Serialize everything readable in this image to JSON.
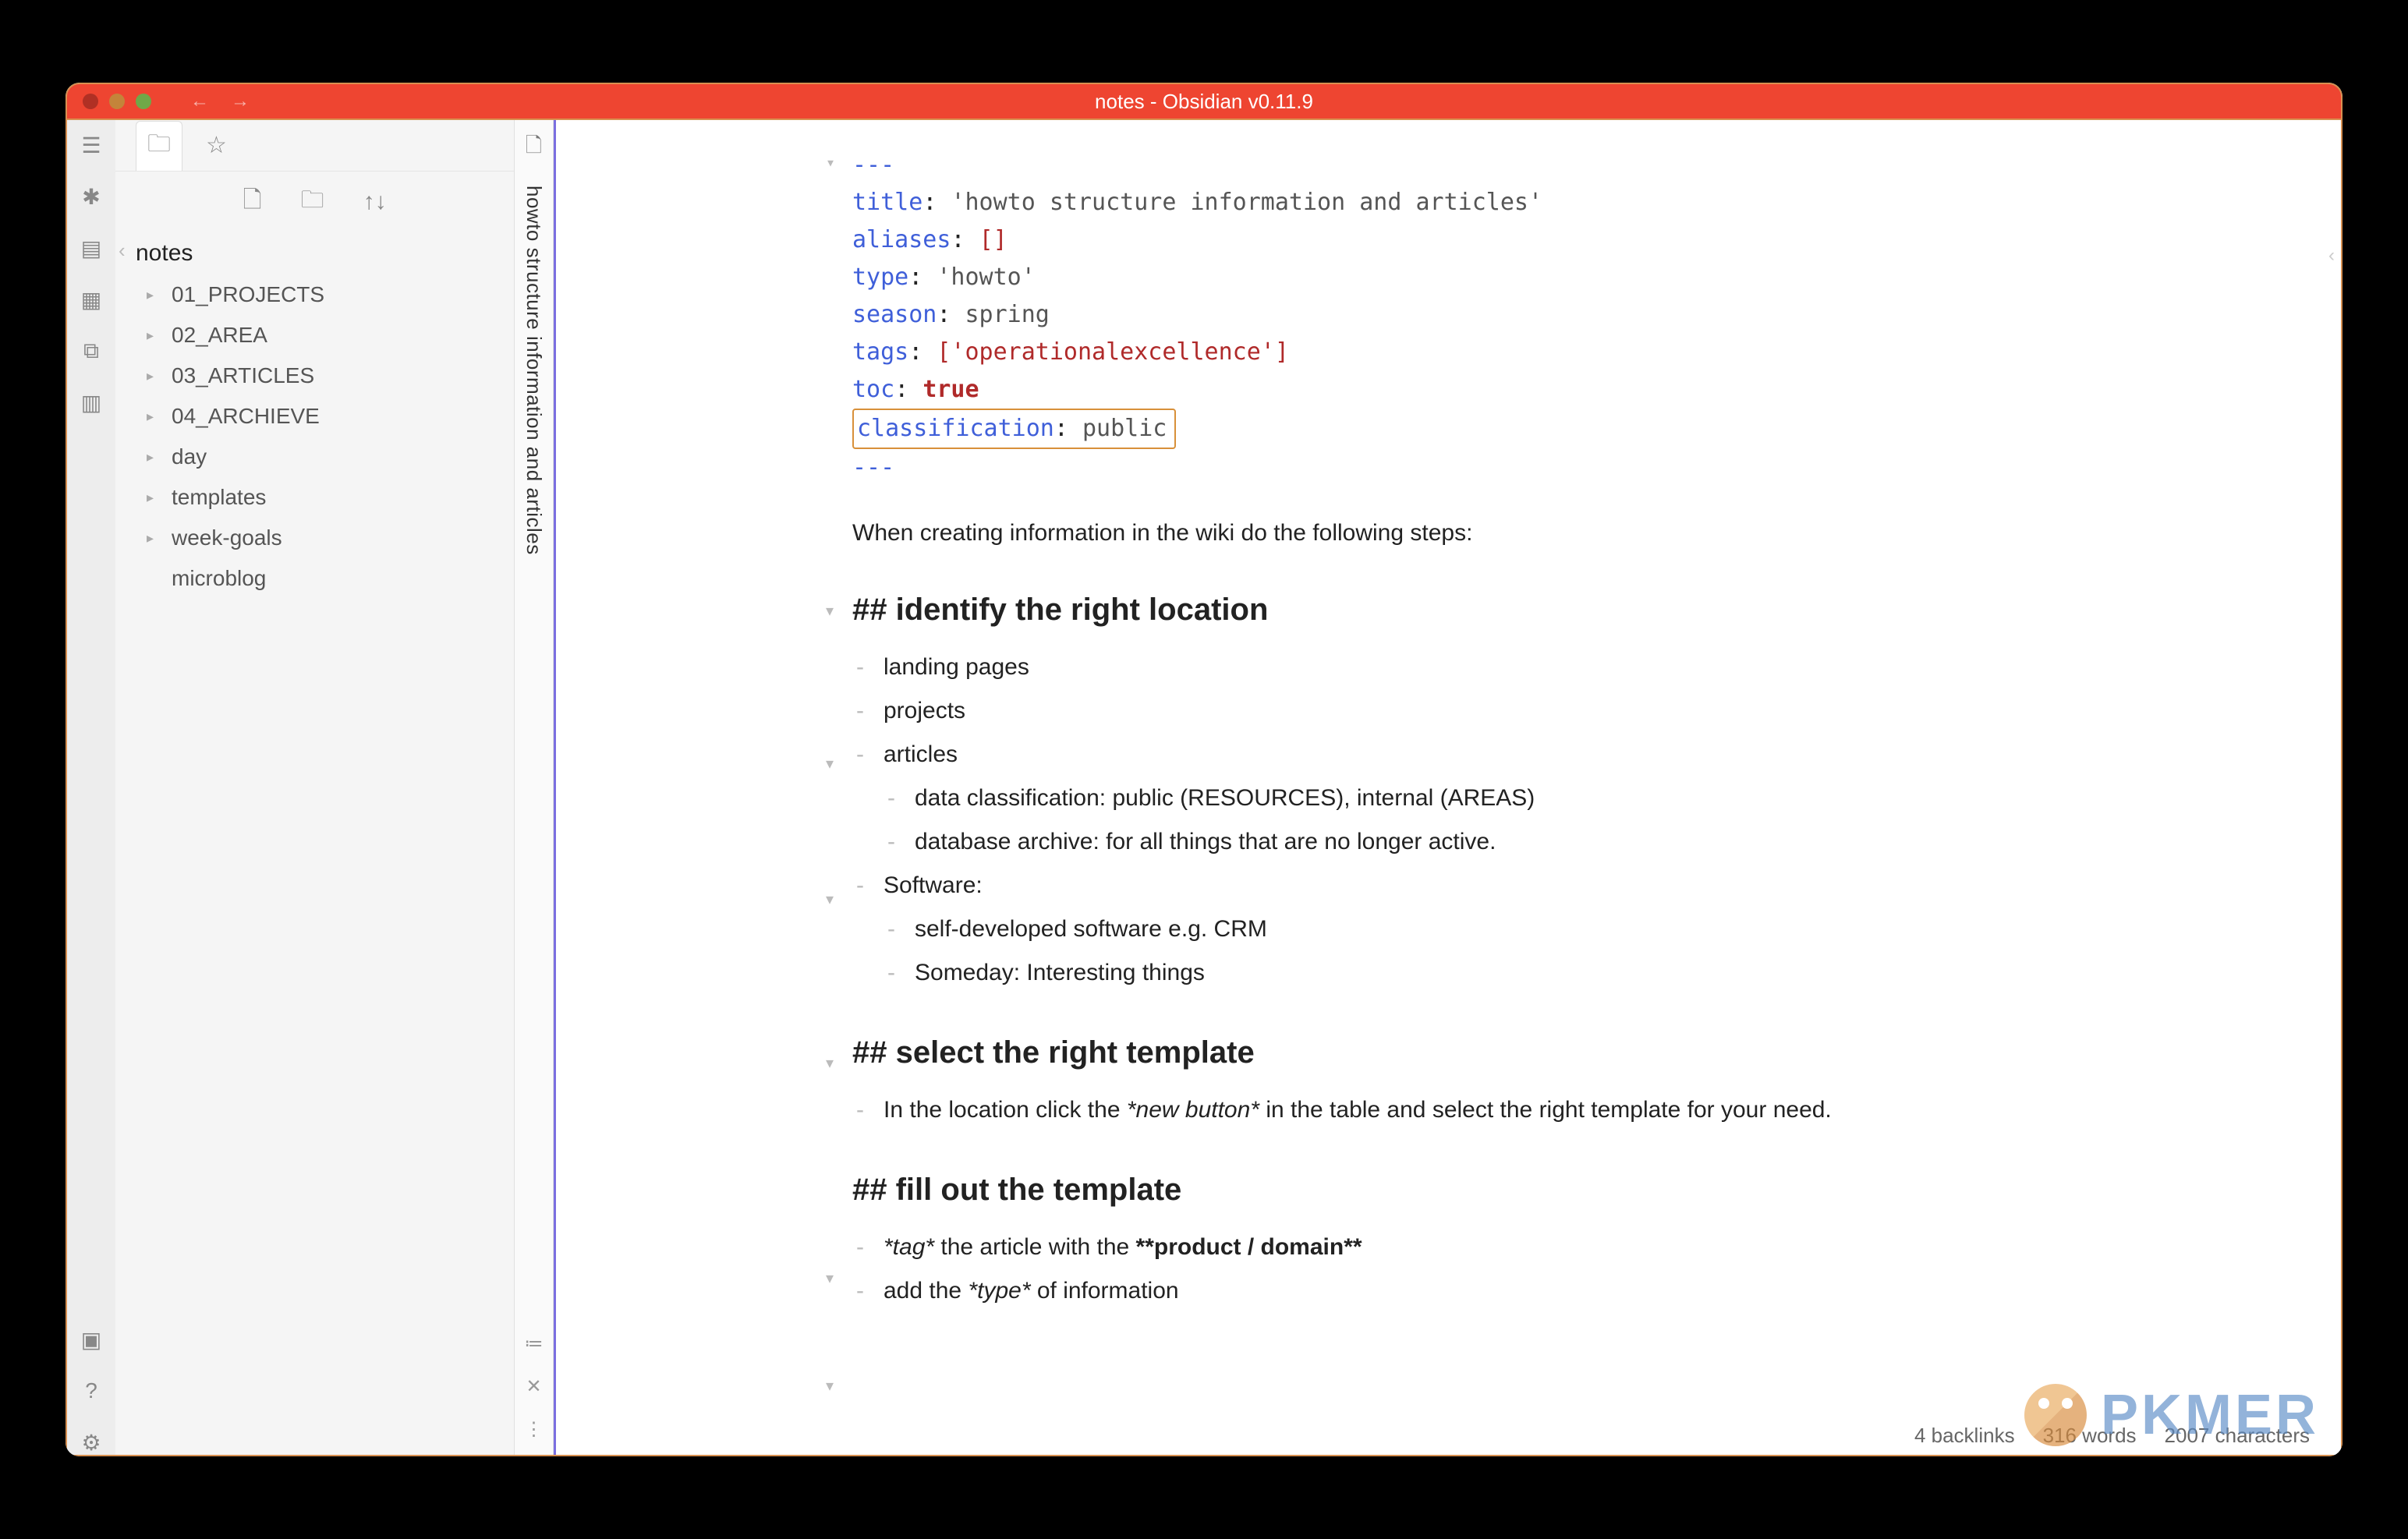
{
  "titlebar": {
    "title": "notes - Obsidian v0.11.9"
  },
  "sidebar": {
    "vault": "notes",
    "tree": [
      {
        "label": "01_PROJECTS",
        "folder": true
      },
      {
        "label": "02_AREA",
        "folder": true
      },
      {
        "label": "03_ARTICLES",
        "folder": true
      },
      {
        "label": "04_ARCHIEVE",
        "folder": true
      },
      {
        "label": "day",
        "folder": true
      },
      {
        "label": "templates",
        "folder": true
      },
      {
        "label": "week-goals",
        "folder": true
      },
      {
        "label": "microblog",
        "folder": false
      }
    ]
  },
  "tab": {
    "title": "howto structure information and articles"
  },
  "frontmatter": {
    "delim": "---",
    "lines": {
      "title_key": "title",
      "title_val": "'howto structure information and articles'",
      "aliases_key": "aliases",
      "aliases_val": "[]",
      "type_key": "type",
      "type_val": "'howto'",
      "season_key": "season",
      "season_val": "spring",
      "tags_key": "tags",
      "tags_val": "['operationalexcellence']",
      "toc_key": "toc",
      "toc_val": "true",
      "class_key": "classification",
      "class_val": "public"
    }
  },
  "content": {
    "intro": "When creating information in the wiki do the following steps:",
    "h1": "## identify the right location",
    "h1_items": {
      "a": "landing pages",
      "b": "projects",
      "c": "articles",
      "c1": "data classification: public (RESOURCES), internal (AREAS)",
      "c2": "database archive: for all things that are no longer active.",
      "d": "Software:",
      "d1": "self-developed software e.g. CRM",
      "d2": "Someday: Interesting things"
    },
    "h2": "## select the right template",
    "h2_pre": "In the location click the ",
    "h2_em": "*new button*",
    "h2_post": " in the table and select the right template for your need.",
    "h3": "## fill out the template",
    "h3_a_pre": "*tag*",
    "h3_a_mid": " the article with the ",
    "h3_a_strong": "**product / domain**",
    "h3_b_pre": "add the ",
    "h3_b_em": "*type*",
    "h3_b_post": " of information"
  },
  "status": {
    "backlinks": "4 backlinks",
    "words": "316 words",
    "chars": "2007 characters"
  },
  "watermark": "PKMER"
}
